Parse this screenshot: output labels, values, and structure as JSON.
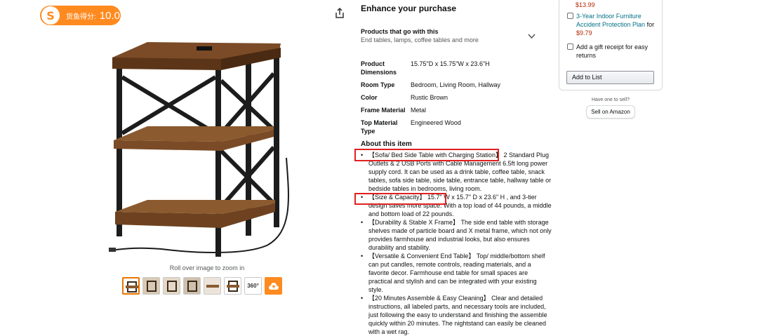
{
  "badge": {
    "label": "货鱼得分:",
    "score": "10.0",
    "color": "#ff8a1f"
  },
  "gallery": {
    "zoom_hint": "Roll over image to zoom in",
    "thumb_360_label": "360°",
    "thumb_count": 8
  },
  "enhance": {
    "title": "Enhance your purchase",
    "goes_with_title": "Products that go with this",
    "goes_with_sub": "End tables, lamps, coffee tables and more"
  },
  "specs": [
    {
      "key": "Product Dimensions",
      "value": "15.75\"D x 15.75\"W x 23.6\"H"
    },
    {
      "key": "Room Type",
      "value": "Bedroom, Living Room, Hallway"
    },
    {
      "key": "Color",
      "value": "Rustic Brown"
    },
    {
      "key": "Frame Material",
      "value": "Metal"
    },
    {
      "key": "Top Material Type",
      "value": "Engineered Wood"
    }
  ],
  "about": {
    "title": "About this item",
    "bullets": [
      "【Sofa/ Bed Side Table with Charging Station】 2 Standard Plug Outlets & 2 USB Ports with Cable Management 6.5ft long power supply cord. It can be used as a drink table, coffee table, snack tables, sofa side table, side table, entrance table, hallway table or bedside tables in bedrooms, living room.",
      "【Size & Capacity】 15.7\" W x 15.7\" D x 23.6\" H , and 3-tier design saves more space. With a top load of 44 pounds, a middle and bottom load of 22 pounds.",
      "【Durability & Stable X Frame】 The side end table with storage shelves made of particle board and X metal frame, which not only provides farmhouse and industrial looks, but also ensures durability and stability.",
      "【Versatile & Convenient End Table】 Top/ middle/bottom shelf can put candles, remote controls, reading materials, and a favorite decor. Farmhouse end table for small spaces are practical and stylish and can be integrated with your existing style.",
      "【20 Minutes Assemble & Easy Cleaning】 Clear and detailed instructions, all labeled parts, and necessary tools are included, just following the easy to understand and finishing the assemble quickly within 20 minutes. The nightstand can easily be cleaned with a wet rag."
    ]
  },
  "buybox": {
    "price_top": "$13.99",
    "protection_link": "3-Year Indoor Furniture Accident Protection Plan",
    "protection_for": " for ",
    "protection_price": "$9.79",
    "gift_receipt": "Add a gift receipt for easy returns",
    "add_to_list": "Add to List",
    "have_one": "Have one to sell?",
    "sell_on_amazon": "Sell on Amazon"
  }
}
